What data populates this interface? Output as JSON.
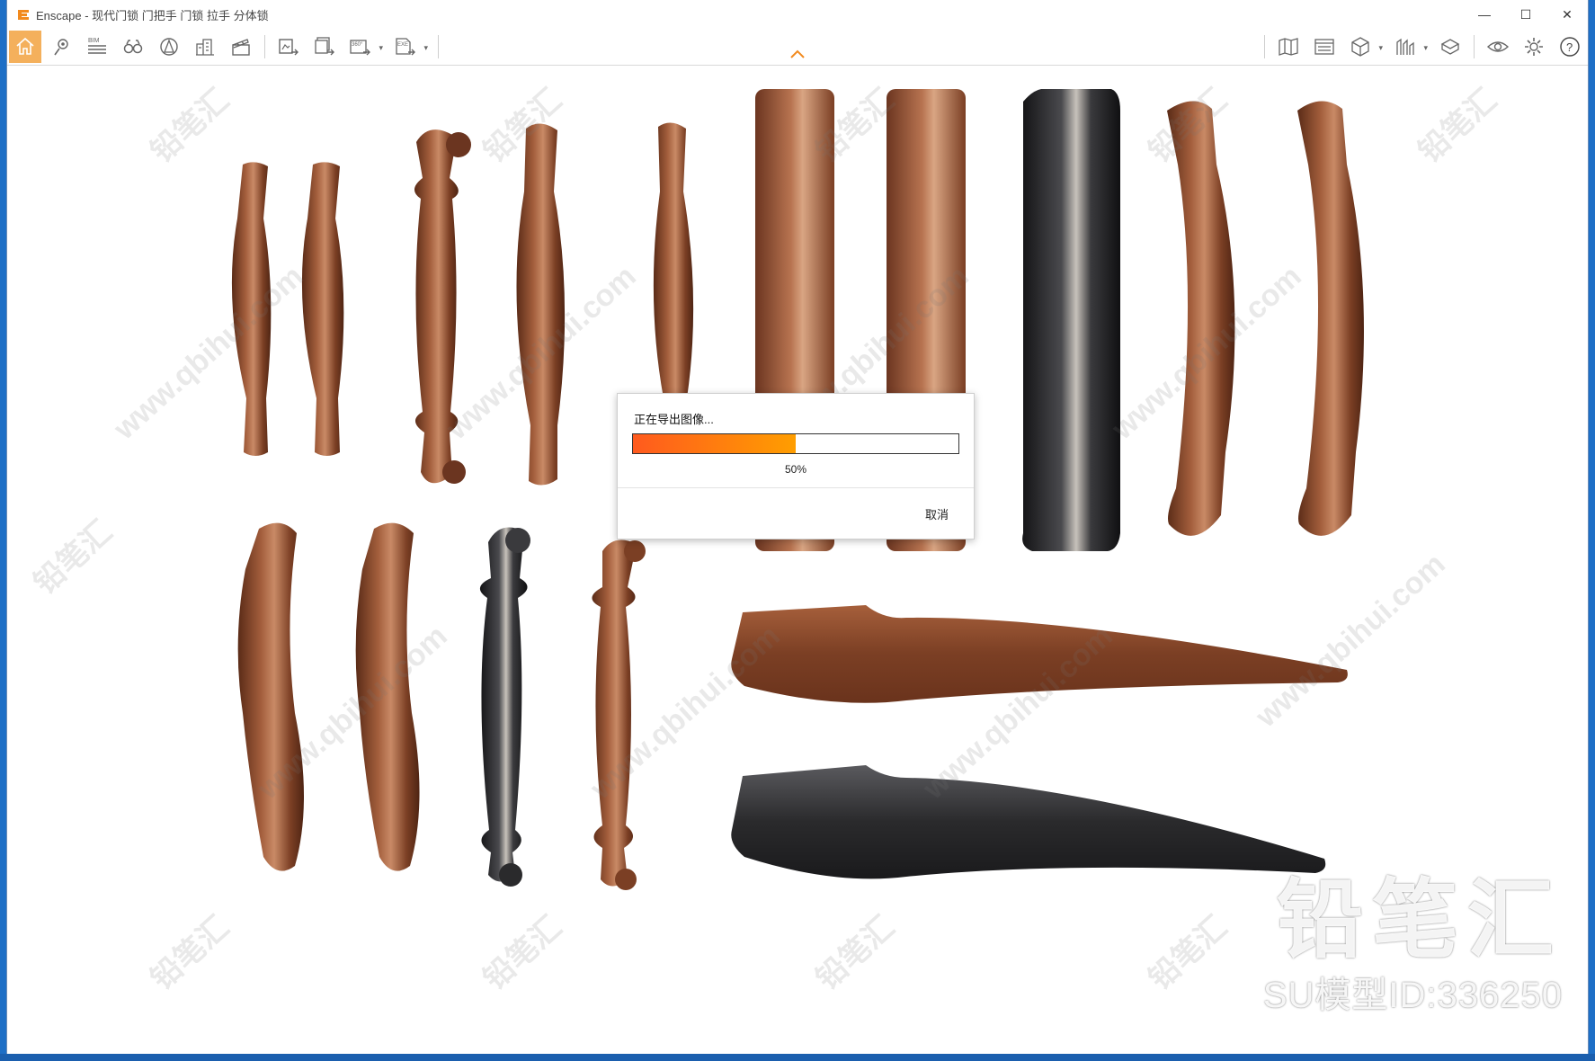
{
  "window": {
    "title": "Enscape - 现代门锁 门把手 门锁 拉手 分体锁",
    "controls": {
      "minimize": "—",
      "maximize": "☐",
      "close": "✕"
    }
  },
  "toolbar": {
    "left_group_1": [
      "home-icon",
      "location-pin-icon",
      "bim-icon",
      "binoculars-icon",
      "atlas-icon",
      "buildings-icon",
      "clapperboard-icon"
    ],
    "bim_label": "BIM",
    "left_group_2": [
      "export-image-icon",
      "batch-export-icon",
      "export-panorama-icon",
      "export-exe-icon"
    ],
    "panorama_label": "360°",
    "exe_label": "EXE",
    "right_group": [
      "map-icon",
      "material-editor-icon",
      "cube-icon",
      "visual-settings-icon",
      "asset-library-icon",
      "eye-icon",
      "gear-icon",
      "help-icon"
    ],
    "help_label": "?",
    "accent_color": "#f7a233"
  },
  "dialog": {
    "title": "正在导出图像...",
    "progress": 50,
    "progress_text": "50%",
    "cancel_label": "取消"
  },
  "viewport": {
    "watermark_text": [
      "铅笔汇",
      "www.qbihui.com"
    ],
    "brand_name": "铅笔汇",
    "model_id_text": "SU模型ID:336250",
    "colors": {
      "brown": "#7b3f24",
      "dark": "#2a2a2c",
      "background": "#ffffff"
    }
  }
}
